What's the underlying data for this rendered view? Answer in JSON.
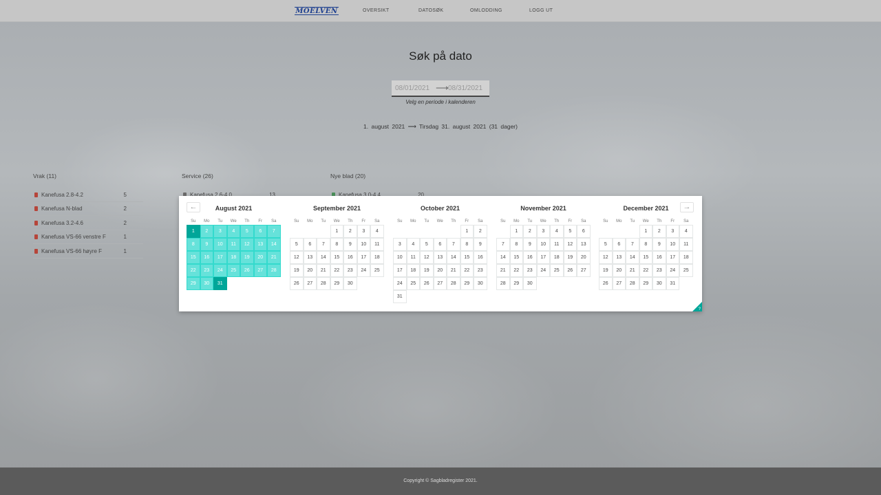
{
  "nav": {
    "logo": "MOELVEN",
    "links": [
      "OVERSIKT",
      "DATOSØK",
      "OMLODDING",
      "LOGG UT"
    ]
  },
  "page": {
    "title": "Søk på dato",
    "start_date": "08/01/2021",
    "end_date": "08/31/2021",
    "hint": "Velg en periode i kalenderen",
    "range_text": "1. august 2021 ⟶ Tirsdag 31. august 2021 (31 dager)"
  },
  "lists": [
    {
      "title": "Vrak (11)",
      "items": [
        {
          "name": "Kanefusa 2.8-4.2",
          "count": "5"
        },
        {
          "name": "Kanefusa N-blad",
          "count": "2"
        },
        {
          "name": "Kanefusa 3.2-4.6",
          "count": "2"
        },
        {
          "name": "Kanefusa VS-66 venstre F",
          "count": "1"
        },
        {
          "name": "Kanefusa VS-66 høyre F",
          "count": "1"
        }
      ]
    },
    {
      "title": "Service (26)",
      "items": [
        {
          "name": "Kanefusa 2.6-4.0",
          "count": "13"
        }
      ]
    },
    {
      "title": "Nye blad (20)",
      "items": [
        {
          "name": "Kanefusa 3.0-4.4",
          "count": "20"
        }
      ]
    }
  ],
  "calendar": {
    "weekdays": [
      "Su",
      "Mo",
      "Tu",
      "We",
      "Th",
      "Fr",
      "Sa"
    ],
    "prev_label": "←",
    "next_label": "→",
    "help_label": "?",
    "colors": {
      "range": "#66e2da",
      "endpoint": "#00a699"
    },
    "months": [
      {
        "title": "August 2021",
        "first_weekday": 0,
        "days": 31,
        "range_start": 1,
        "range_end": 31
      },
      {
        "title": "September 2021",
        "first_weekday": 3,
        "days": 30
      },
      {
        "title": "October 2021",
        "first_weekday": 5,
        "days": 31
      },
      {
        "title": "November 2021",
        "first_weekday": 1,
        "days": 30
      },
      {
        "title": "December 2021",
        "first_weekday": 3,
        "days": 31
      }
    ]
  },
  "footer": {
    "copyright": "Copyright © Sagbladregister 2021."
  }
}
